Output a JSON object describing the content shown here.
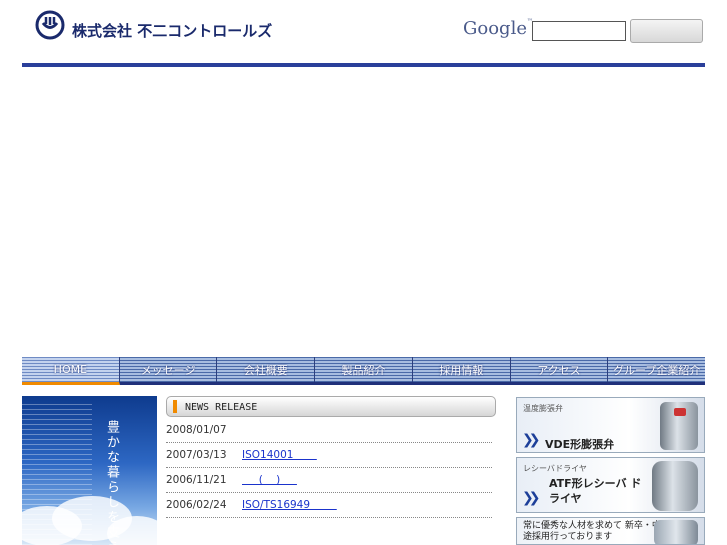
{
  "header": {
    "company_name": "株式会社 不二コントロールズ",
    "search_logo": "Google",
    "search_logo_tm": "™",
    "search_value": "",
    "search_button_label": ""
  },
  "nav": {
    "items": [
      {
        "label": "HOME"
      },
      {
        "label": "メッセージ"
      },
      {
        "label": "会社概要"
      },
      {
        "label": "製品紹介"
      },
      {
        "label": "採用情報"
      },
      {
        "label": "アクセス"
      },
      {
        "label": "グループ企業紹介"
      }
    ]
  },
  "banner": {
    "text": "豊かな暮らしを支える"
  },
  "news": {
    "title": "NEWS RELEASE",
    "items": [
      {
        "date": "2008/01/07",
        "link": ""
      },
      {
        "date": "2007/03/13",
        "link": "ISO14001       "
      },
      {
        "date": "2006/11/21",
        "link": "     (    )     "
      },
      {
        "date": "2006/02/24",
        "link": "ISO/TS16949        "
      }
    ]
  },
  "promos": [
    {
      "category": "温度膨張弁",
      "name": "VDE形膨張弁",
      "icon": "expansion-valve-photo"
    },
    {
      "category": "レシーバドライヤ",
      "name": "ATF形レシーバ ドライヤ",
      "icon": "receiver-dryer-photo"
    },
    {
      "category": "",
      "name": "常に優秀な人材を求めて 新卒・中途採用行っております",
      "icon": "recruit-photo"
    }
  ],
  "colors": {
    "brand_navy": "#2a3f9a",
    "nav_active_accent": "#f08a00",
    "link": "#1a33cc"
  }
}
